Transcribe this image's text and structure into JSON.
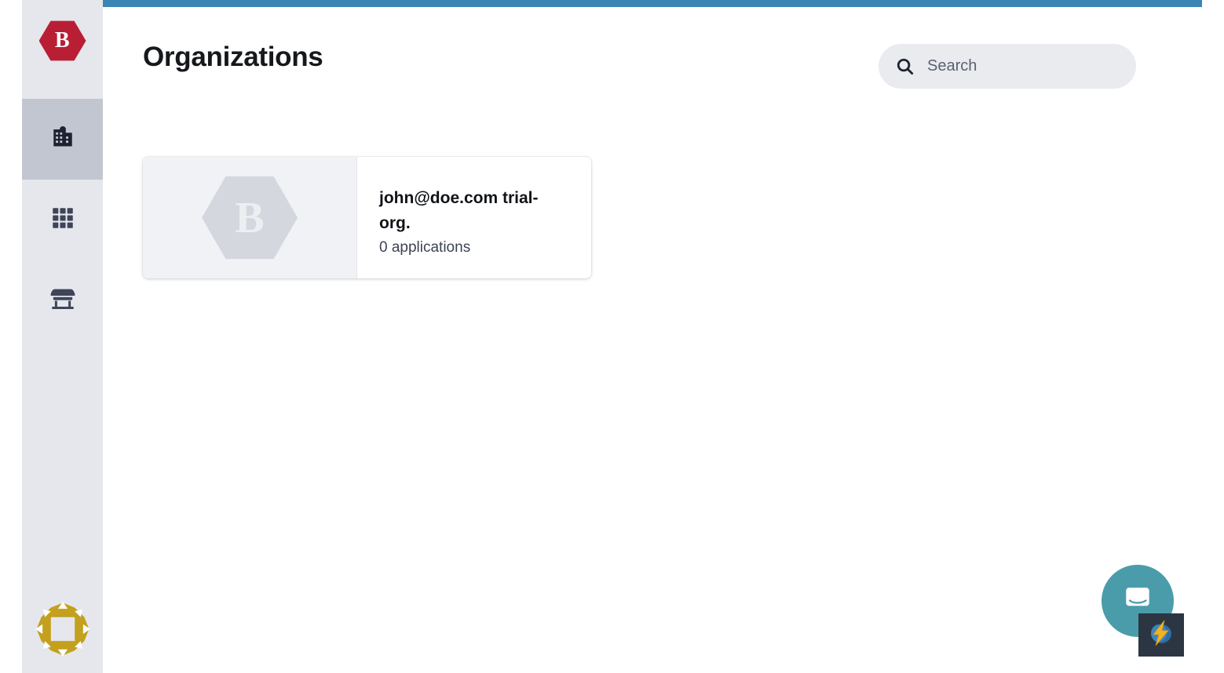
{
  "app": {
    "brand_letter": "B",
    "accent_bar_color": "#3a85b3",
    "brand_color": "#b81f35",
    "sidebar_bg": "#e5e7ec",
    "sidebar_active_bg": "#c1c6d0"
  },
  "sidebar": {
    "logo_name": "bonita-logo",
    "items": [
      {
        "name": "organizations",
        "icon": "building-icon",
        "active": true
      },
      {
        "name": "applications",
        "icon": "grid-icon",
        "active": false
      },
      {
        "name": "marketplace",
        "icon": "storefront-icon",
        "active": false
      }
    ],
    "footer_logo": {
      "name": "keycloak-logo",
      "color": "#c3a01e"
    }
  },
  "header": {
    "title": "Organizations"
  },
  "search": {
    "placeholder": "Search",
    "value": "",
    "icon": "search-icon"
  },
  "organizations": [
    {
      "logo_letter": "B",
      "name": "john@doe.com trial-org.",
      "applications_label": "0 applications"
    }
  ],
  "widgets": {
    "chat_launcher": {
      "name": "intercom-chat-launcher",
      "icon": "chat-bubble-icon",
      "color": "#4a9cab"
    },
    "extension_badge": {
      "name": "lightning-extension-badge",
      "icon": "lightning-bolt-icon",
      "color": "#2b3642"
    }
  }
}
